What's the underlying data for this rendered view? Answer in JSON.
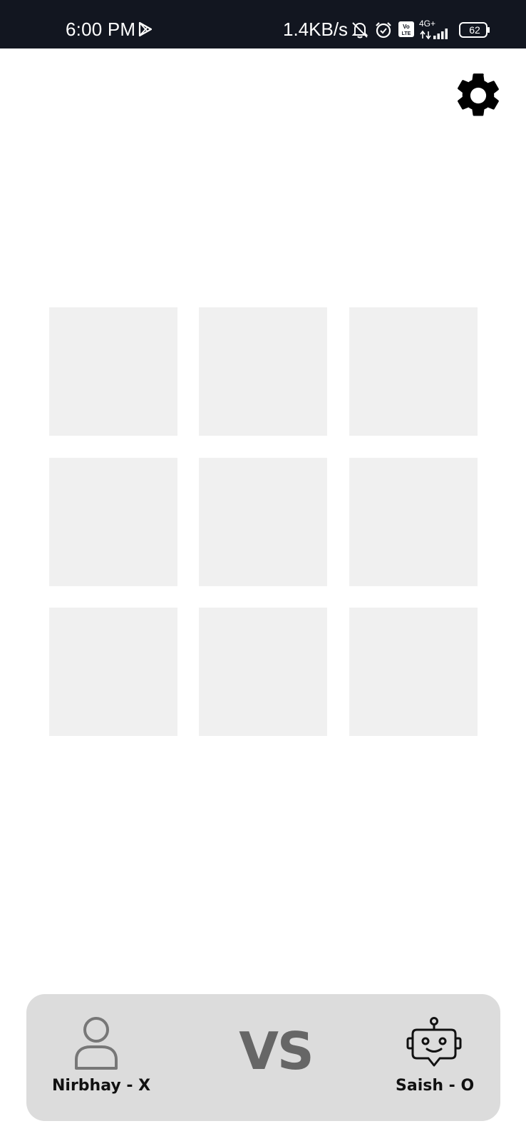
{
  "status_bar": {
    "time": "6:00 PM",
    "net_speed": "1.4KB/s",
    "network_type": "4G+",
    "volte": "Vo LTE",
    "battery": "62",
    "icons": [
      "play-store-icon",
      "bell-off-icon",
      "alarm-icon",
      "volte-icon",
      "signal-icon",
      "battery-icon"
    ]
  },
  "toolbar": {
    "settings_icon": "gear-icon"
  },
  "board": {
    "cells": [
      "",
      "",
      "",
      "",
      "",
      "",
      "",
      "",
      ""
    ],
    "cell_color": "#f0f0f0"
  },
  "players": {
    "player1": {
      "name": "Nirbhay - X",
      "icon": "person-icon"
    },
    "vs_label": "VS",
    "player2": {
      "name": "Saish - O",
      "icon": "robot-icon"
    },
    "card_color": "#dcdcdc"
  }
}
